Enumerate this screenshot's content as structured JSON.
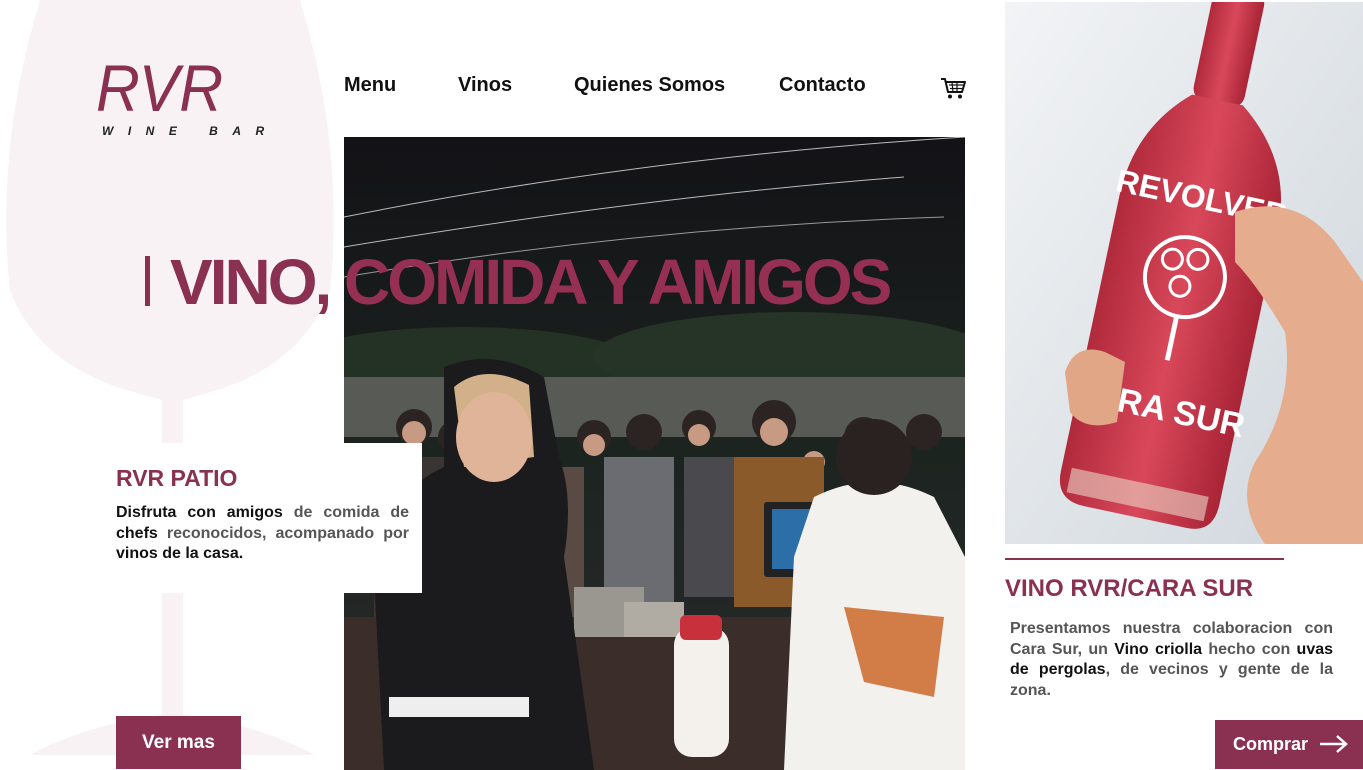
{
  "brand": {
    "logo_text": "RVR",
    "logo_subtitle": "WINE BAR",
    "accent_color": "#8a3050"
  },
  "nav": {
    "items": [
      {
        "label": "Menu"
      },
      {
        "label": "Vinos"
      },
      {
        "label": "Quienes Somos"
      },
      {
        "label": "Contacto"
      }
    ],
    "cart_icon": "shopping-cart-icon"
  },
  "hero": {
    "title_part1": "VINO,",
    "title_part2": "COMIDA Y AMIGOS"
  },
  "patio": {
    "title": "RVR PATIO",
    "text": {
      "s1": "Disfruta con amigos",
      "s2": " de comida de ",
      "s3": "chefs",
      "s4": " reconocidos, acompanado por ",
      "s5": "vinos de la casa."
    },
    "button_label": "Ver mas"
  },
  "product": {
    "title": "VINO RVR/CARA SUR",
    "bottle_label_top": "REVOLVER",
    "bottle_label_bottom": "CARA SUR",
    "text": {
      "s1": "Presentamos nuestra colaboracion con Cara Sur, un ",
      "s2": "Vino criolla",
      "s3": " hecho con ",
      "s4": "uvas de pergolas",
      "s5": ", de vecinos y gente de la zona."
    },
    "button_label": "Comprar",
    "button_icon": "arrow-right-icon"
  }
}
